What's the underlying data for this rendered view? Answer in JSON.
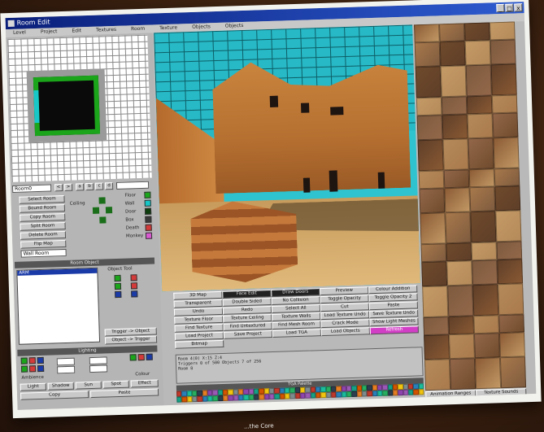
{
  "window": {
    "title": "Room Edit",
    "menu": [
      "Level",
      "Project",
      "Edit",
      "Textures",
      "Room",
      "Texture",
      "Objects",
      "Objects"
    ],
    "controls": [
      "_",
      "□",
      "x"
    ]
  },
  "left": {
    "room_field": "Room0",
    "room_buttons": [
      "Select Room",
      "Bound Room",
      "Copy Room",
      "Split Room",
      "Delete Room",
      "Flip Map"
    ],
    "room_name_field": "Wall Room",
    "labels": {
      "ceiling": "Ceiling",
      "floor": "Floor",
      "wall": "Wall",
      "door": "Door",
      "box": "Box",
      "death": "Death",
      "monkey": "Monkey"
    },
    "object_panel_title": "Room Object",
    "object_list_item": "ARM",
    "object_tool_title": "Object Tool",
    "object_buttons": [
      "Trigger -> Object",
      "Object -> Trigger"
    ],
    "lighting_title": "Lighting",
    "lighting_labels": [
      "Ambience",
      "Colour"
    ],
    "bottom_buttons": [
      "Light",
      "Shadow",
      "Sun",
      "Spot",
      "Effect",
      "Copy",
      "Paste"
    ]
  },
  "viewport": {},
  "buttons": [
    [
      "3D Map",
      "Face Edit",
      "Draw Doors",
      "Preview",
      "Colour Addition"
    ],
    [
      "Transparent",
      "Double Sided",
      "No Collision",
      "Toggle Opacity",
      "Toggle Opacity 2"
    ],
    [
      "Undo",
      "Redo",
      "Select All",
      "Cut",
      "Paste"
    ],
    [
      "Texture Floor",
      "Texture Ceiling",
      "Texture Walls",
      "Load Texture Undo",
      "Save Texture Undo"
    ],
    [
      "Find Texture",
      "Find Untextured",
      "Find Mesh Room",
      "Crack Mode",
      "Show Light Meshes"
    ],
    [
      "Load Project",
      "Save Project",
      "Load TGA",
      "Load Objects",
      "Refresh"
    ],
    [
      "Bitmap",
      "",
      "",
      "",
      ""
    ]
  ],
  "console": {
    "lines": [
      "Room 4(0) X:15 Z:4",
      "Triggers 0 of 500   Objects 7 of 256",
      "Room 8"
    ]
  },
  "palette_title": "TGA Palette",
  "textures": {
    "buttons": [
      "Animation Ranges",
      "Texture Sounds"
    ]
  },
  "colors": {
    "window_bg": "#b9b9b9",
    "sky": "#2ec3cf",
    "sand": "#c9843e",
    "accent_pink": "#d23fc6"
  },
  "caption": "...the Core"
}
